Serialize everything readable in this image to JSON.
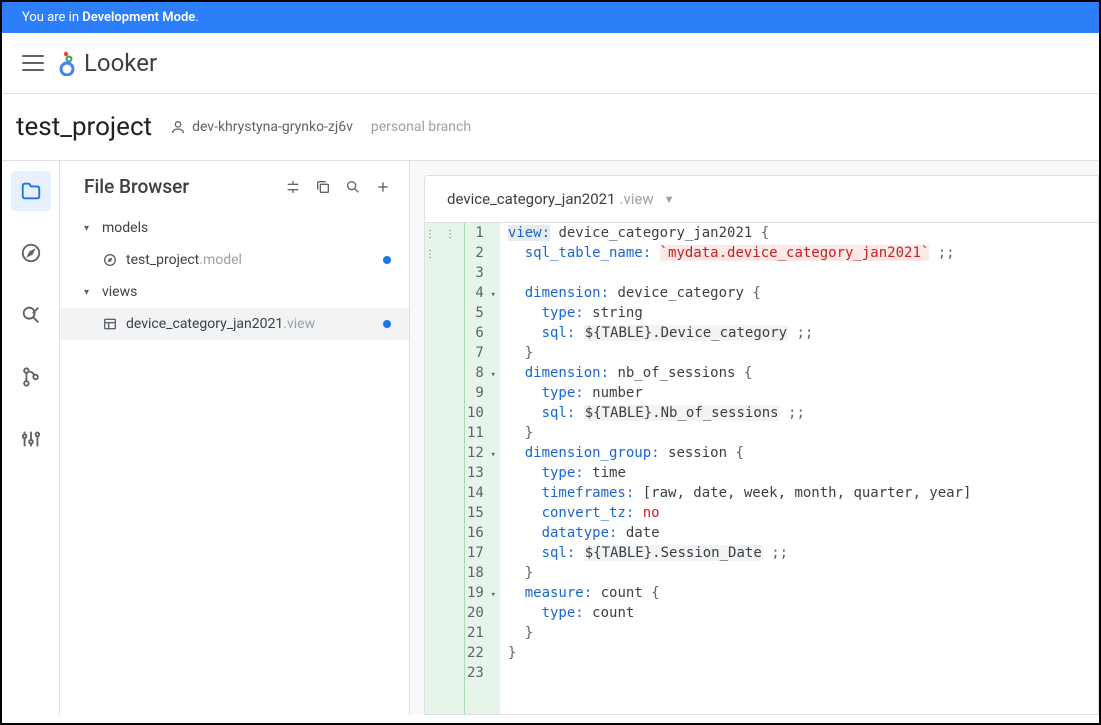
{
  "banner": {
    "prefix": "You are in ",
    "mode": "Development Mode",
    "suffix": "."
  },
  "brand": {
    "name": "Looker"
  },
  "project": {
    "title": "test_project",
    "branch": "dev-khrystyna-grynko-zj6v",
    "branch_label": "personal branch"
  },
  "file_browser": {
    "title": "File Browser"
  },
  "tree": {
    "models_label": "models",
    "model_file_base": "test_project",
    "model_file_ext": ".model",
    "views_label": "views",
    "view_file_base": "device_category_jan2021",
    "view_file_ext": ".view"
  },
  "editor_tab": {
    "base": "device_category_jan2021",
    "ext": ".view"
  },
  "code": {
    "lines": [
      {
        "n": 1,
        "fold": false
      },
      {
        "n": 2,
        "fold": false
      },
      {
        "n": 3,
        "fold": false
      },
      {
        "n": 4,
        "fold": true
      },
      {
        "n": 5,
        "fold": false
      },
      {
        "n": 6,
        "fold": false
      },
      {
        "n": 7,
        "fold": false
      },
      {
        "n": 8,
        "fold": true
      },
      {
        "n": 9,
        "fold": false
      },
      {
        "n": 10,
        "fold": false
      },
      {
        "n": 11,
        "fold": false
      },
      {
        "n": 12,
        "fold": true
      },
      {
        "n": 13,
        "fold": false
      },
      {
        "n": 14,
        "fold": false
      },
      {
        "n": 15,
        "fold": false
      },
      {
        "n": 16,
        "fold": false
      },
      {
        "n": 17,
        "fold": false
      },
      {
        "n": 18,
        "fold": false
      },
      {
        "n": 19,
        "fold": true
      },
      {
        "n": 20,
        "fold": false
      },
      {
        "n": 21,
        "fold": false
      },
      {
        "n": 22,
        "fold": false
      },
      {
        "n": 23,
        "fold": false
      }
    ],
    "l1": {
      "view": "view:",
      "name": "device_category_jan2021",
      "brace": "{"
    },
    "l2": {
      "key": "sql_table_name:",
      "val": "`mydata.device_category_jan2021`",
      "end": ";;"
    },
    "l4": {
      "key": "dimension:",
      "name": "device_category",
      "brace": "{"
    },
    "l5": {
      "key": "type:",
      "val": "string"
    },
    "l6": {
      "key": "sql:",
      "var": "${TABLE}",
      "rest": ".Device_category",
      "end": ";;"
    },
    "l7": {
      "brace": "}"
    },
    "l8": {
      "key": "dimension:",
      "name": "nb_of_sessions",
      "brace": "{"
    },
    "l9": {
      "key": "type:",
      "val": "number"
    },
    "l10": {
      "key": "sql:",
      "var": "${TABLE}",
      "rest": ".Nb_of_sessions",
      "end": ";;"
    },
    "l11": {
      "brace": "}"
    },
    "l12": {
      "key": "dimension_group:",
      "name": "session",
      "brace": "{"
    },
    "l13": {
      "key": "type:",
      "val": "time"
    },
    "l14": {
      "key": "timeframes:",
      "val": "[raw, date, week, month, quarter, year]"
    },
    "l15": {
      "key": "convert_tz:",
      "val": "no"
    },
    "l16": {
      "key": "datatype:",
      "val": "date"
    },
    "l17": {
      "key": "sql:",
      "var": "${TABLE}",
      "rest": ".Session_Date",
      "end": ";;"
    },
    "l18": {
      "brace": "}"
    },
    "l19": {
      "key": "measure:",
      "name": "count",
      "brace": "{"
    },
    "l20": {
      "key": "type:",
      "val": "count"
    },
    "l21": {
      "brace": "}"
    },
    "l22": {
      "brace": "}"
    }
  }
}
